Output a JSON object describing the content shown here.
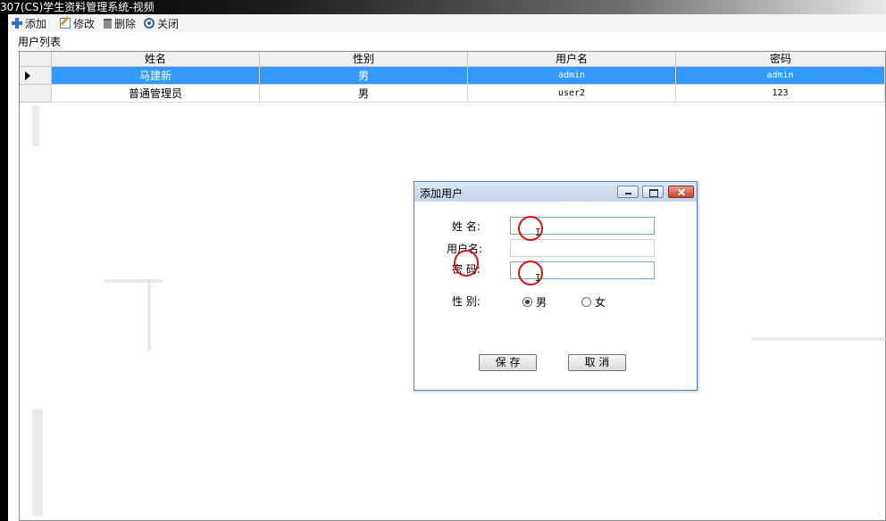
{
  "window": {
    "title": "307(CS)学生资料管理系统-视频"
  },
  "toolbar": {
    "items": [
      {
        "label": "添加",
        "icon": "plus-icon"
      },
      {
        "label": "修改",
        "icon": "edit-icon"
      },
      {
        "label": "删除",
        "icon": "trash-icon"
      },
      {
        "label": "关闭",
        "icon": "close-circle-icon"
      }
    ]
  },
  "group": {
    "label": "用户列表"
  },
  "grid": {
    "columns": [
      "姓名",
      "性别",
      "用户名",
      "密码"
    ],
    "rows": [
      {
        "name": "马建新",
        "gender": "男",
        "username": "admin",
        "password": "admin",
        "selected": true
      },
      {
        "name": "普通管理员",
        "gender": "男",
        "username": "user2",
        "password": "123",
        "selected": false
      }
    ]
  },
  "dialog": {
    "title": "添加用户",
    "fields": {
      "name_label": "姓 名:",
      "username_label": "用户名:",
      "password_label": "密 码:",
      "gender_label": "性 别:",
      "name_value": "",
      "username_value": "",
      "password_value": ""
    },
    "gender_options": {
      "male": "男",
      "female": "女",
      "selected": "男"
    },
    "buttons": {
      "save": "保 存",
      "cancel": "取 消"
    }
  },
  "colors": {
    "selection": "#3399ff",
    "annotation": "#e01010",
    "accent": "#5b82b5"
  }
}
